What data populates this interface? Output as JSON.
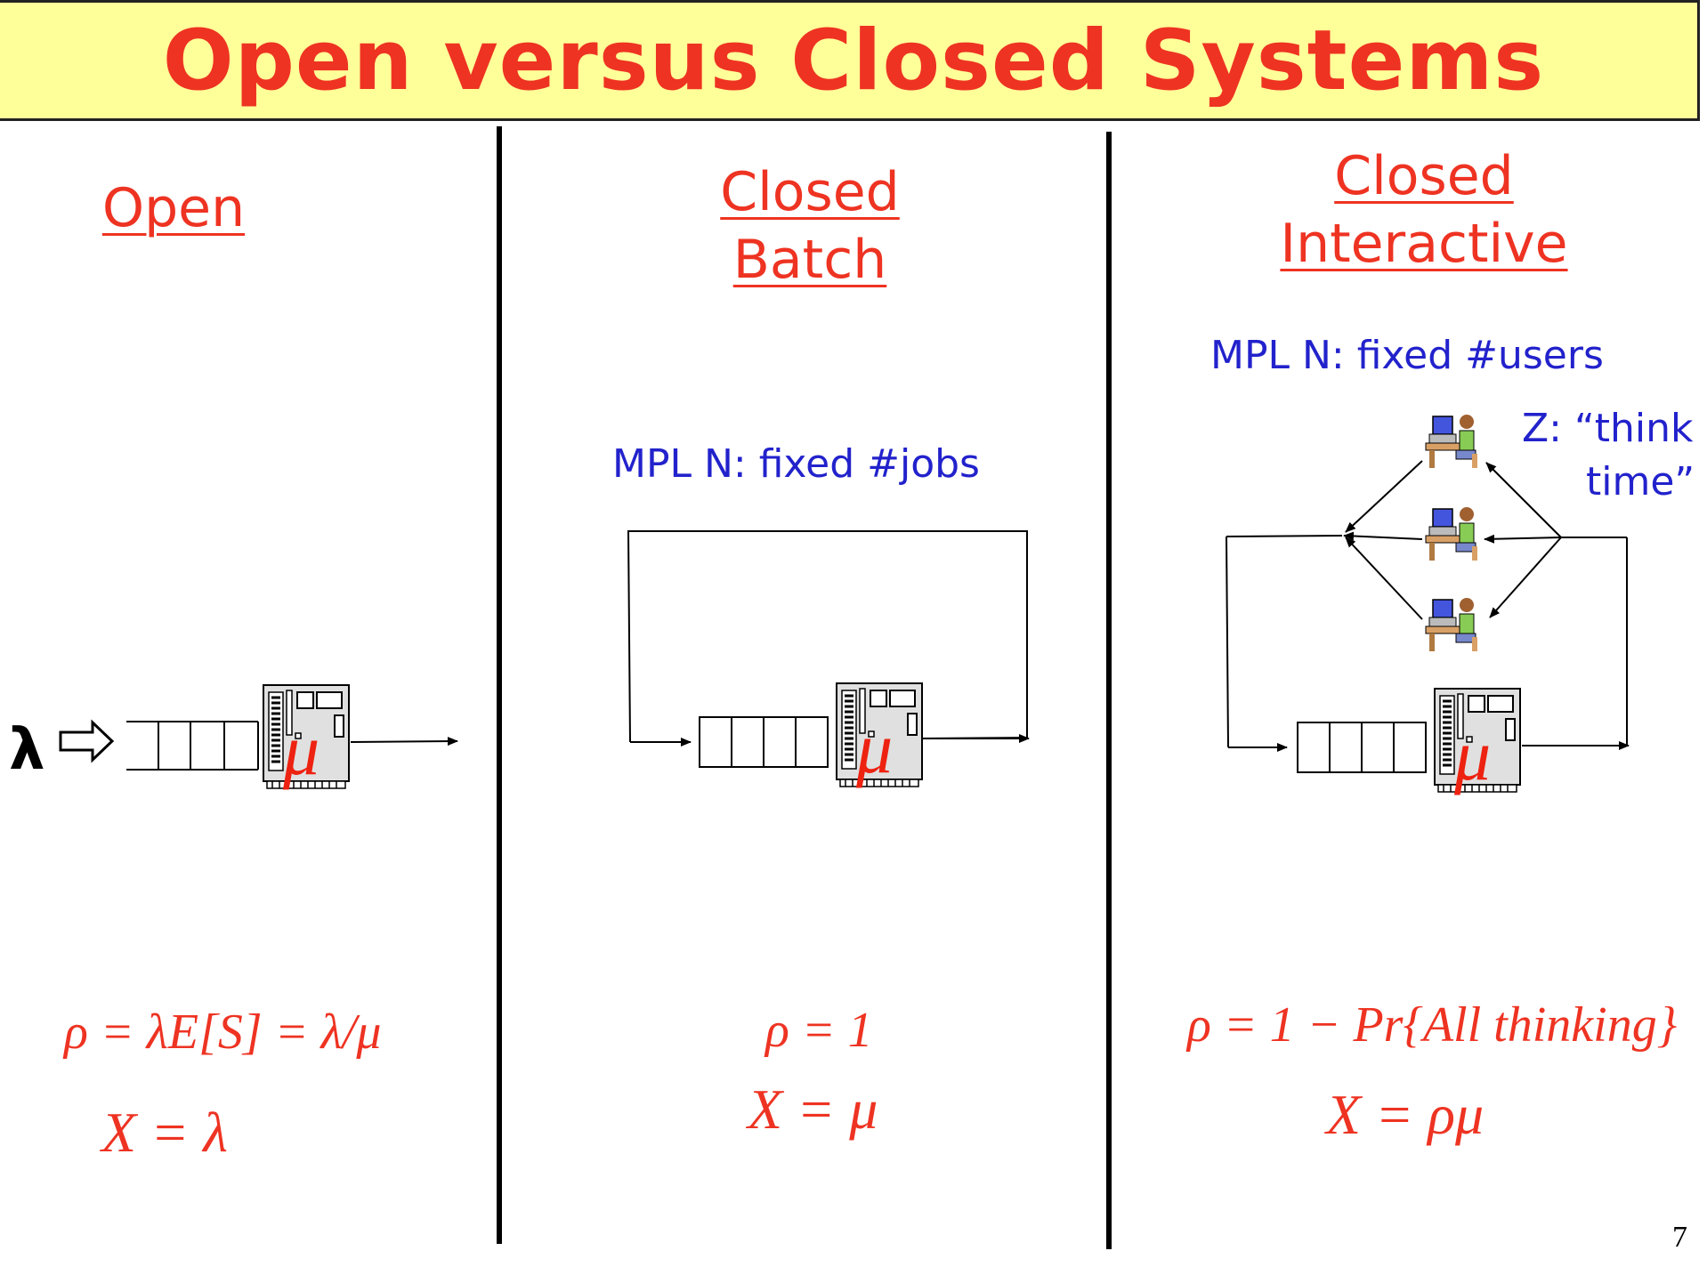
{
  "title": "Open versus Closed Systems",
  "columns": {
    "open": {
      "heading": "Open",
      "arrival_symbol": "λ",
      "server_rate_symbol": "μ",
      "formula_rho": "ρ = λE[S] = λ/μ",
      "formula_x": "X = λ"
    },
    "batch": {
      "heading_line1": "Closed",
      "heading_line2": "Batch",
      "mpl_text": "MPL N:  fixed #jobs",
      "server_rate_symbol": "μ",
      "formula_rho": "ρ = 1",
      "formula_x": "X = μ"
    },
    "interactive": {
      "heading_line1": "Closed",
      "heading_line2": "Interactive",
      "mpl_text": "MPL N:  fixed #users",
      "think_line1": "Z: “think",
      "think_line2": "time”",
      "server_rate_symbol": "μ",
      "formula_rho": "ρ = 1 − Pr{All thinking}",
      "formula_x": "X = ρμ"
    }
  },
  "page_number": "7",
  "colors": {
    "title_bg": "#ffff99",
    "accent_red": "#ee3322",
    "mpl_blue": "#2222cc"
  }
}
